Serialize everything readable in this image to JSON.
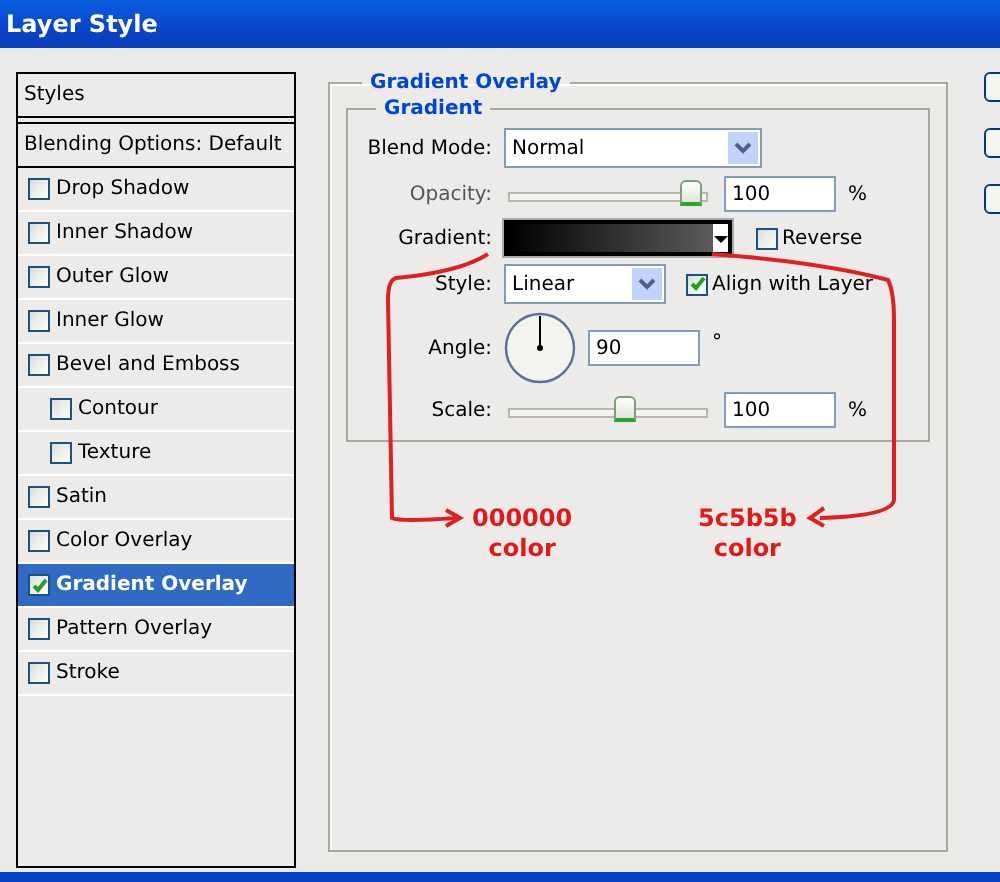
{
  "window": {
    "title": "Layer Style"
  },
  "sidebar": {
    "header": "Styles",
    "blending": "Blending Options: Default",
    "items": [
      {
        "label": "Drop Shadow",
        "checked": false,
        "selected": false
      },
      {
        "label": "Inner Shadow",
        "checked": false,
        "selected": false
      },
      {
        "label": "Outer Glow",
        "checked": false,
        "selected": false
      },
      {
        "label": "Inner Glow",
        "checked": false,
        "selected": false
      },
      {
        "label": "Bevel and Emboss",
        "checked": false,
        "selected": false,
        "children": [
          {
            "label": "Contour",
            "checked": false,
            "selected": false
          },
          {
            "label": "Texture",
            "checked": false,
            "selected": false
          }
        ]
      },
      {
        "label": "Satin",
        "checked": false,
        "selected": false
      },
      {
        "label": "Color Overlay",
        "checked": false,
        "selected": false
      },
      {
        "label": "Gradient Overlay",
        "checked": true,
        "selected": true
      },
      {
        "label": "Pattern Overlay",
        "checked": false,
        "selected": false
      },
      {
        "label": "Stroke",
        "checked": false,
        "selected": false
      }
    ]
  },
  "panel": {
    "title": "Gradient Overlay",
    "group": "Gradient",
    "blend_mode": {
      "label": "Blend Mode:",
      "value": "Normal"
    },
    "opacity": {
      "label": "Opacity:",
      "value": "100",
      "unit": "%",
      "level": 0.97
    },
    "gradient": {
      "label": "Gradient:",
      "reverse": {
        "label": "Reverse",
        "checked": false
      }
    },
    "style": {
      "label": "Style:",
      "value": "Linear",
      "align": {
        "label": "Align with Layer",
        "checked": true
      }
    },
    "angle": {
      "label": "Angle:",
      "value": "90",
      "unit": "°"
    },
    "scale": {
      "label": "Scale:",
      "value": "100",
      "unit": "%",
      "level": 0.6
    }
  },
  "annotations": [
    {
      "code": "000000",
      "word": "color"
    },
    {
      "code": "5c5b5b",
      "word": "color"
    }
  ]
}
